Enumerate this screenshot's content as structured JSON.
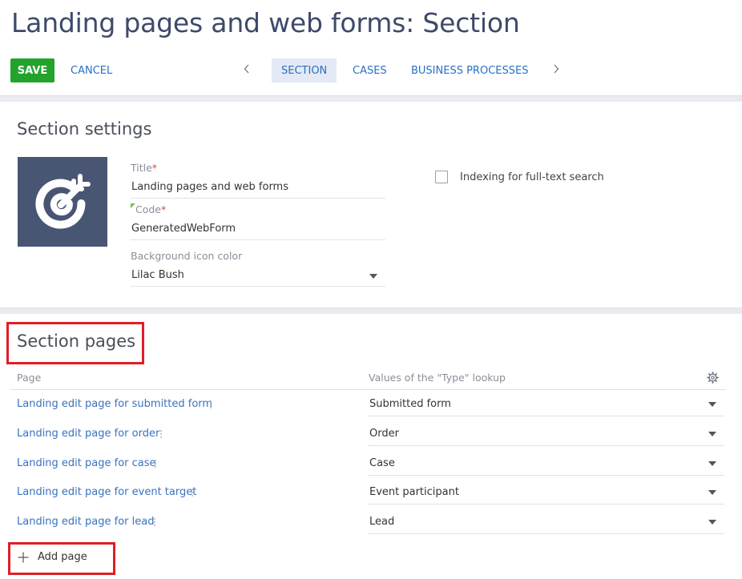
{
  "page": {
    "title": "Landing pages and web forms: Section"
  },
  "toolbar": {
    "save_label": "SAVE",
    "cancel_label": "CANCEL",
    "tabs": [
      {
        "label": "SECTION",
        "active": true
      },
      {
        "label": "CASES",
        "active": false
      },
      {
        "label": "BUSINESS PROCESSES",
        "active": false
      }
    ]
  },
  "section_settings": {
    "heading": "Section settings",
    "icon": "target-arrow-icon",
    "icon_background_color": "#485674",
    "title_field": {
      "label": "Title",
      "value": "Landing pages and web forms"
    },
    "code_field": {
      "label": "Code",
      "value": "GeneratedWebForm"
    },
    "bg_color_field": {
      "label": "Background icon color",
      "value": "Lilac Bush"
    },
    "indexing": {
      "label": "Indexing for full-text search",
      "checked": false
    }
  },
  "section_pages": {
    "heading": "Section pages",
    "columns": {
      "page": "Page",
      "type": "Values of the \"Type\" lookup"
    },
    "rows": [
      {
        "page": "Landing edit page for submitted form",
        "type": "Submitted form"
      },
      {
        "page": "Landing edit page for order",
        "type": "Order"
      },
      {
        "page": "Landing edit page for case",
        "type": "Case"
      },
      {
        "page": "Landing edit page for event target",
        "type": "Event participant"
      },
      {
        "page": "Landing edit page for lead",
        "type": "Lead"
      }
    ],
    "add_page_label": "Add page"
  },
  "colors": {
    "save_button": "#22a32c",
    "link": "#2a70c4",
    "active_tab": "#e3e9f5",
    "highlight": "#e01e25"
  }
}
